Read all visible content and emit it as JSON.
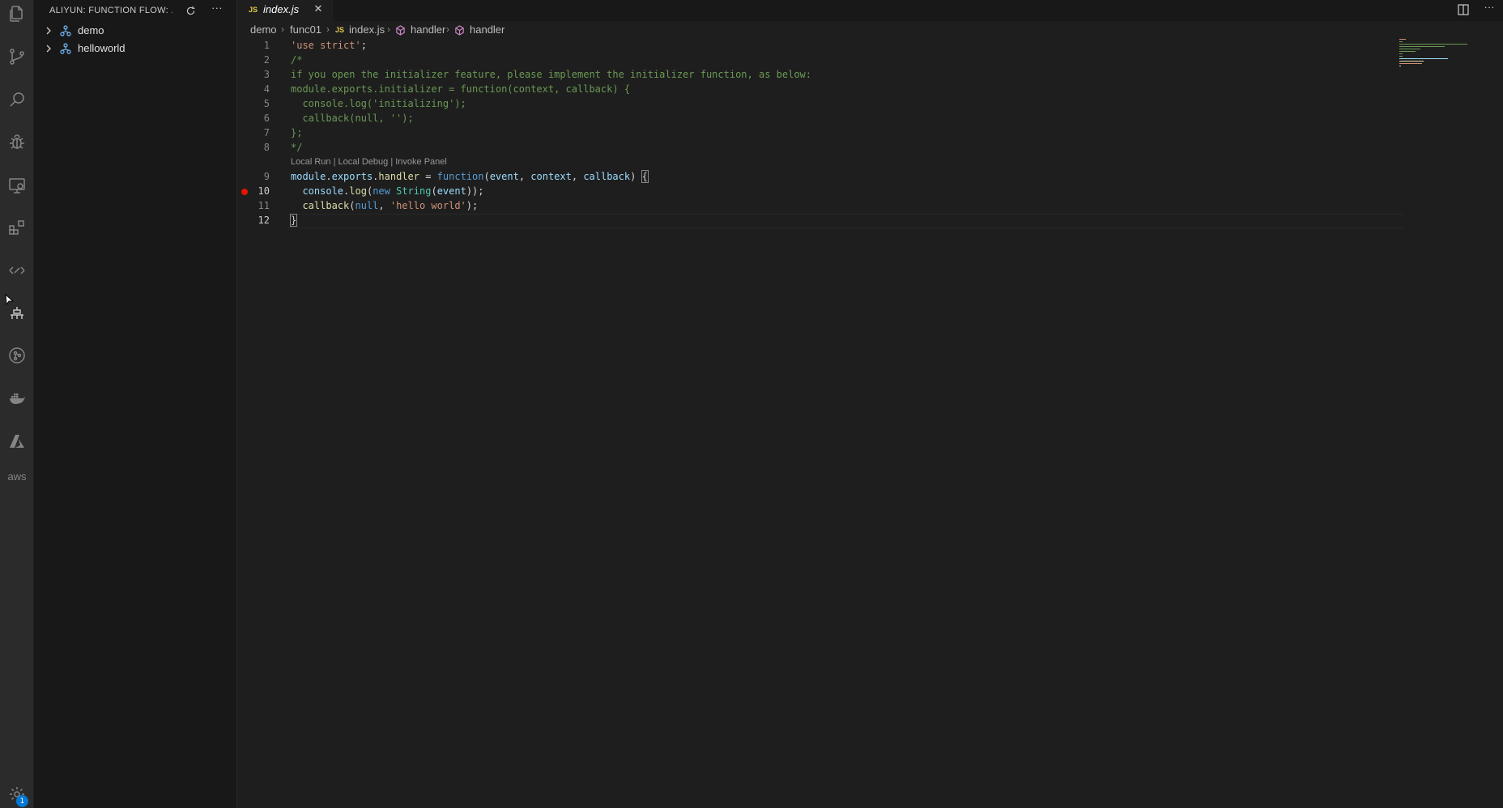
{
  "activity_bar": {
    "icons": [
      "files-icon",
      "source-control-icon",
      "search-icon",
      "debug-icon",
      "remote-explorer-icon",
      "extensions-icon",
      "ali-function-flow-icon",
      "ali-cloud-icon",
      "gitlens-icon",
      "docker-icon",
      "azure-icon",
      "aws-icon"
    ],
    "aws_label": "aws",
    "settings_badge": "1"
  },
  "sidebar": {
    "title": "ALIYUN: FUNCTION FLOW: ...",
    "items": [
      {
        "label": "demo"
      },
      {
        "label": "helloworld"
      }
    ]
  },
  "tabs": [
    {
      "badge": "JS",
      "label": "index.js",
      "close": "✕"
    }
  ],
  "toolbar": {
    "more": "···"
  },
  "breadcrumb": {
    "items": [
      "demo",
      "func01",
      "index.js",
      "handler",
      "handler"
    ],
    "js_badge": "JS",
    "sep": "›"
  },
  "editor": {
    "line_numbers": [
      "1",
      "2",
      "3",
      "4",
      "5",
      "6",
      "7",
      "8",
      "9",
      "10",
      "11",
      "12"
    ],
    "codelens": "Local Run | Local Debug | Invoke Panel",
    "lines": {
      "l1": [
        "'use strict'",
        ";"
      ],
      "l2": "/*",
      "l3": "if you open the initializer feature, please implement the initializer function, as below:",
      "l4": "module.exports.initializer = function(context, callback) {",
      "l5": "  console.log('initializing');",
      "l6": "  callback(null, '');",
      "l7": "};",
      "l8": "*/",
      "l9": [
        "module",
        ".",
        "exports",
        ".",
        "handler",
        " = ",
        "function",
        "(",
        "event",
        ", ",
        "context",
        ", ",
        "callback",
        ") ",
        "{"
      ],
      "l10": [
        "  ",
        "console",
        ".",
        "log",
        "(",
        "new",
        " ",
        "String",
        "(",
        "event",
        "));"
      ],
      "l11": [
        "  ",
        "callback",
        "(",
        "null",
        ", ",
        "'hello world'",
        ");"
      ],
      "l12": "}"
    },
    "breakpoint_line": "10"
  },
  "colors": {
    "background": "#1e1e1e",
    "sidebar": "#181818",
    "activity_bar": "#2b2b2b",
    "string": "#ce9178",
    "comment": "#6a9955",
    "keyword": "#569cd6",
    "breakpoint": "#e51400",
    "badge": "#0078d4"
  }
}
